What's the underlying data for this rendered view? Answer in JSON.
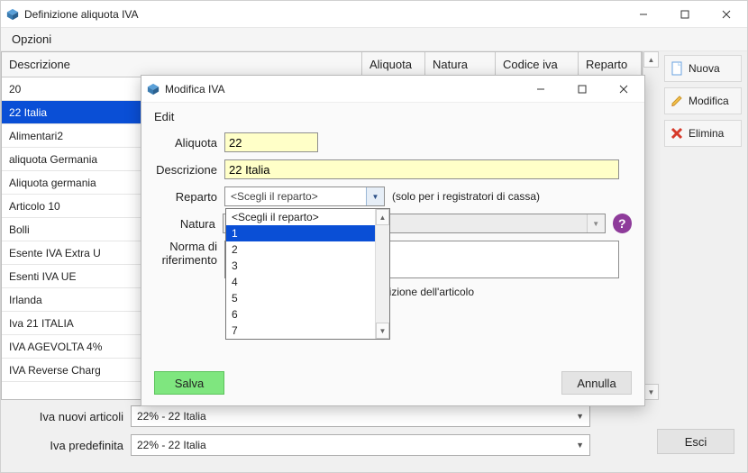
{
  "main_window": {
    "title": "Definizione aliquota IVA",
    "menu": {
      "opzioni": "Opzioni"
    },
    "grid": {
      "headers": {
        "desc": "Descrizione",
        "aliq": "Aliquota",
        "nat": "Natura",
        "cod": "Codice iva",
        "rep": "Reparto"
      },
      "rows": [
        "20",
        "22 Italia",
        "Alimentari2",
        "aliquota Germania",
        "Aliquota germania",
        "Articolo 10",
        "Bolli",
        "Esente IVA Extra U",
        "Esenti IVA UE",
        "Irlanda",
        "Iva 21 ITALIA",
        "IVA AGEVOLTA 4%",
        "IVA Reverse Charg"
      ],
      "selected_index": 1
    },
    "side": {
      "nuova": "Nuova",
      "modifica": "Modifica",
      "elimina": "Elimina"
    },
    "bottom": {
      "iva_nuovi_label": "Iva nuovi articoli",
      "iva_nuovi_value": "22% - 22 Italia",
      "iva_pred_label": "Iva predefinita",
      "iva_pred_value": "22% - 22 Italia",
      "esci": "Esci"
    }
  },
  "dialog": {
    "title": "Modifica IVA",
    "edit_label": "Edit",
    "labels": {
      "aliquota": "Aliquota",
      "descrizione": "Descrizione",
      "reparto": "Reparto",
      "natura": "Natura",
      "norma1": "Norma di",
      "norma2": "riferimento"
    },
    "values": {
      "aliquota": "22",
      "descrizione": "22 Italia",
      "reparto_placeholder": "<Scegli il reparto>",
      "natura_placeholder": ""
    },
    "hints": {
      "reparto": "(solo per i registratori di cassa)"
    },
    "include_text": "escrizione dell'articolo",
    "buttons": {
      "salva": "Salva",
      "annulla": "Annulla"
    },
    "help_icon": "?"
  },
  "dropdown": {
    "items": [
      "<Scegli il reparto>",
      "1",
      "2",
      "3",
      "4",
      "5",
      "6",
      "7"
    ],
    "highlight_index": 1
  }
}
